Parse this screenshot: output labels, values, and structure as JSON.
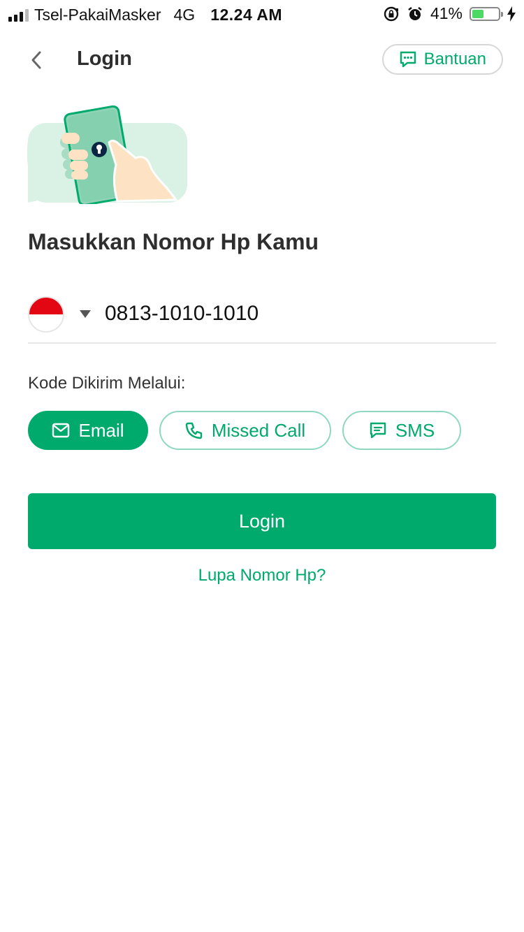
{
  "status_bar": {
    "carrier": "Tsel-PakaiMasker",
    "network": "4G",
    "time": "12.24 AM",
    "battery_percent": "41%",
    "battery_level": 0.41
  },
  "header": {
    "title": "Login",
    "help_label": "Bantuan"
  },
  "main": {
    "heading": "Masukkan Nomor Hp Kamu",
    "phone": {
      "value": "0813-1010-1010",
      "country_flag": "indonesia-flag-icon"
    },
    "code_label": "Kode Dikirim Melalui:",
    "methods": [
      {
        "label": "Email",
        "icon": "mail-icon",
        "selected": true
      },
      {
        "label": "Missed Call",
        "icon": "phone-icon",
        "selected": false
      },
      {
        "label": "SMS",
        "icon": "message-icon",
        "selected": false
      }
    ],
    "login_label": "Login",
    "forgot_label": "Lupa Nomor Hp?"
  },
  "colors": {
    "accent": "#00aa6c",
    "chip_border": "#8fd8bd",
    "flag_red": "#e30613"
  }
}
